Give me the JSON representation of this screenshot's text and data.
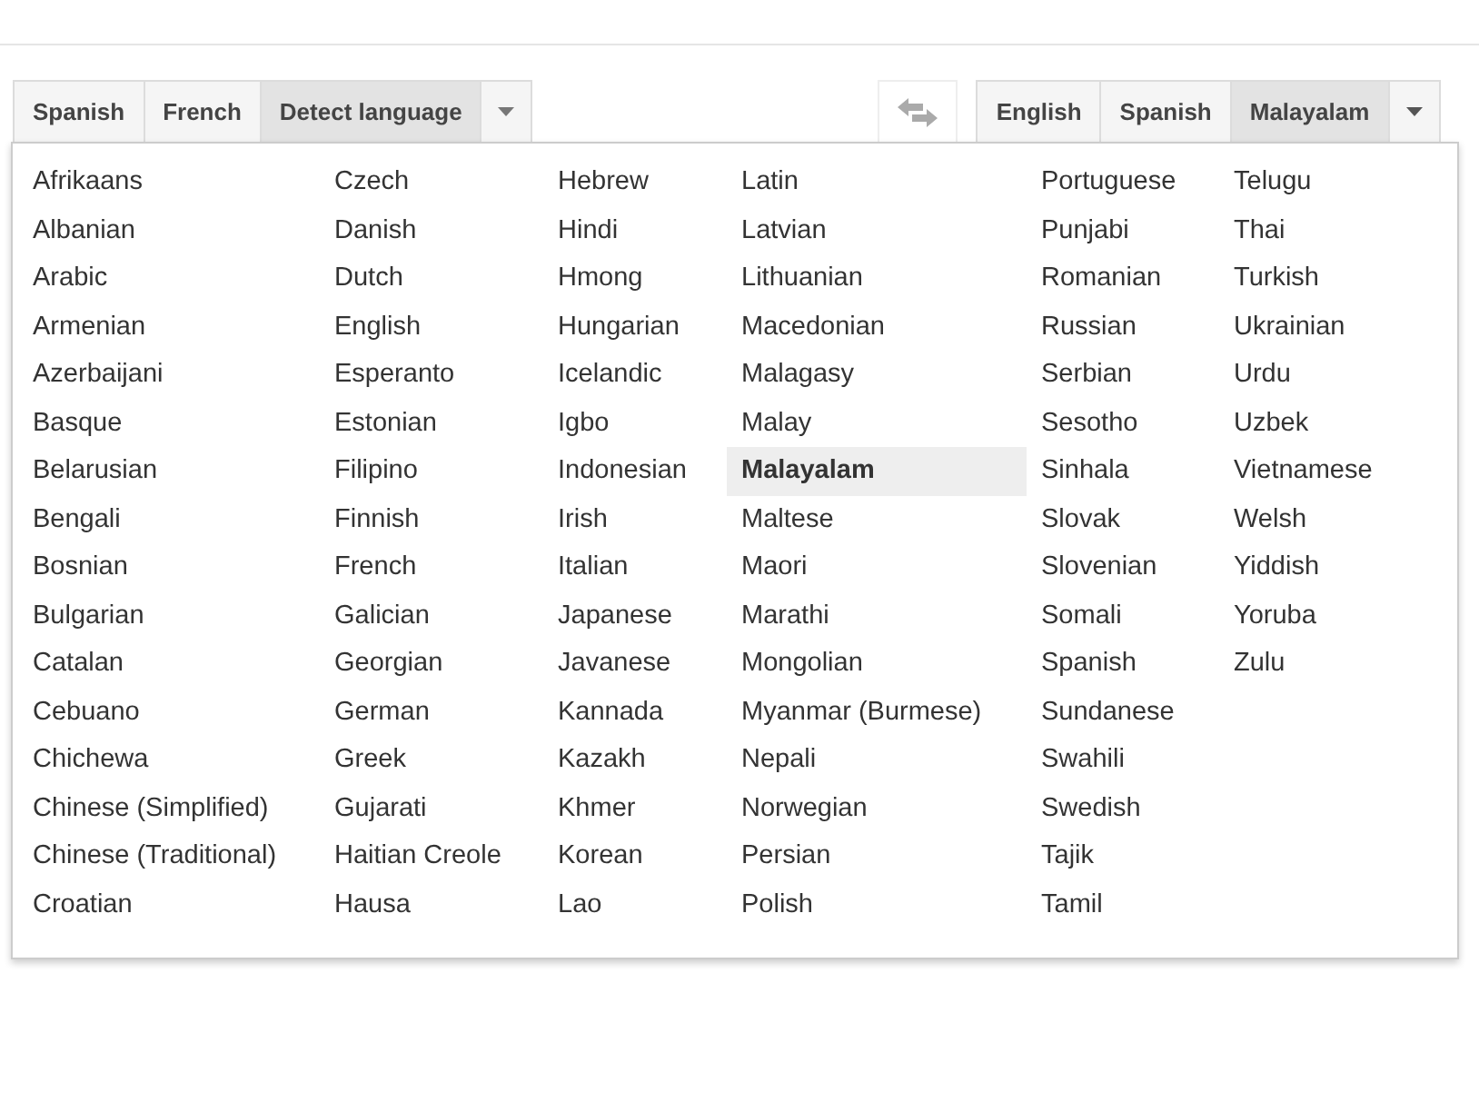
{
  "source_languages": [
    {
      "label": "Spanish",
      "selected": false
    },
    {
      "label": "French",
      "selected": false
    },
    {
      "label": "Detect language",
      "selected": true
    }
  ],
  "target_languages": [
    {
      "label": "English",
      "selected": false
    },
    {
      "label": "Spanish",
      "selected": false
    },
    {
      "label": "Malayalam",
      "selected": true
    }
  ],
  "language_menu": {
    "columns": [
      [
        {
          "label": "Afrikaans",
          "selected": false
        },
        {
          "label": "Albanian",
          "selected": false
        },
        {
          "label": "Arabic",
          "selected": false
        },
        {
          "label": "Armenian",
          "selected": false
        },
        {
          "label": "Azerbaijani",
          "selected": false
        },
        {
          "label": "Basque",
          "selected": false
        },
        {
          "label": "Belarusian",
          "selected": false
        },
        {
          "label": "Bengali",
          "selected": false
        },
        {
          "label": "Bosnian",
          "selected": false
        },
        {
          "label": "Bulgarian",
          "selected": false
        },
        {
          "label": "Catalan",
          "selected": false
        },
        {
          "label": "Cebuano",
          "selected": false
        },
        {
          "label": "Chichewa",
          "selected": false
        },
        {
          "label": "Chinese (Simplified)",
          "selected": false
        },
        {
          "label": "Chinese (Traditional)",
          "selected": false
        },
        {
          "label": "Croatian",
          "selected": false
        }
      ],
      [
        {
          "label": "Czech",
          "selected": false
        },
        {
          "label": "Danish",
          "selected": false
        },
        {
          "label": "Dutch",
          "selected": false
        },
        {
          "label": "English",
          "selected": false
        },
        {
          "label": "Esperanto",
          "selected": false
        },
        {
          "label": "Estonian",
          "selected": false
        },
        {
          "label": "Filipino",
          "selected": false
        },
        {
          "label": "Finnish",
          "selected": false
        },
        {
          "label": "French",
          "selected": false
        },
        {
          "label": "Galician",
          "selected": false
        },
        {
          "label": "Georgian",
          "selected": false
        },
        {
          "label": "German",
          "selected": false
        },
        {
          "label": "Greek",
          "selected": false
        },
        {
          "label": "Gujarati",
          "selected": false
        },
        {
          "label": "Haitian Creole",
          "selected": false
        },
        {
          "label": "Hausa",
          "selected": false
        }
      ],
      [
        {
          "label": "Hebrew",
          "selected": false
        },
        {
          "label": "Hindi",
          "selected": false
        },
        {
          "label": "Hmong",
          "selected": false
        },
        {
          "label": "Hungarian",
          "selected": false
        },
        {
          "label": "Icelandic",
          "selected": false
        },
        {
          "label": "Igbo",
          "selected": false
        },
        {
          "label": "Indonesian",
          "selected": false
        },
        {
          "label": "Irish",
          "selected": false
        },
        {
          "label": "Italian",
          "selected": false
        },
        {
          "label": "Japanese",
          "selected": false
        },
        {
          "label": "Javanese",
          "selected": false
        },
        {
          "label": "Kannada",
          "selected": false
        },
        {
          "label": "Kazakh",
          "selected": false
        },
        {
          "label": "Khmer",
          "selected": false
        },
        {
          "label": "Korean",
          "selected": false
        },
        {
          "label": "Lao",
          "selected": false
        }
      ],
      [
        {
          "label": "Latin",
          "selected": false
        },
        {
          "label": "Latvian",
          "selected": false
        },
        {
          "label": "Lithuanian",
          "selected": false
        },
        {
          "label": "Macedonian",
          "selected": false
        },
        {
          "label": "Malagasy",
          "selected": false
        },
        {
          "label": "Malay",
          "selected": false
        },
        {
          "label": "Malayalam",
          "selected": true
        },
        {
          "label": "Maltese",
          "selected": false
        },
        {
          "label": "Maori",
          "selected": false
        },
        {
          "label": "Marathi",
          "selected": false
        },
        {
          "label": "Mongolian",
          "selected": false
        },
        {
          "label": "Myanmar (Burmese)",
          "selected": false
        },
        {
          "label": "Nepali",
          "selected": false
        },
        {
          "label": "Norwegian",
          "selected": false
        },
        {
          "label": "Persian",
          "selected": false
        },
        {
          "label": "Polish",
          "selected": false
        }
      ],
      [
        {
          "label": "Portuguese",
          "selected": false
        },
        {
          "label": "Punjabi",
          "selected": false
        },
        {
          "label": "Romanian",
          "selected": false
        },
        {
          "label": "Russian",
          "selected": false
        },
        {
          "label": "Serbian",
          "selected": false
        },
        {
          "label": "Sesotho",
          "selected": false
        },
        {
          "label": "Sinhala",
          "selected": false
        },
        {
          "label": "Slovak",
          "selected": false
        },
        {
          "label": "Slovenian",
          "selected": false
        },
        {
          "label": "Somali",
          "selected": false
        },
        {
          "label": "Spanish",
          "selected": false
        },
        {
          "label": "Sundanese",
          "selected": false
        },
        {
          "label": "Swahili",
          "selected": false
        },
        {
          "label": "Swedish",
          "selected": false
        },
        {
          "label": "Tajik",
          "selected": false
        },
        {
          "label": "Tamil",
          "selected": false
        }
      ],
      [
        {
          "label": "Telugu",
          "selected": false
        },
        {
          "label": "Thai",
          "selected": false
        },
        {
          "label": "Turkish",
          "selected": false
        },
        {
          "label": "Ukrainian",
          "selected": false
        },
        {
          "label": "Urdu",
          "selected": false
        },
        {
          "label": "Uzbek",
          "selected": false
        },
        {
          "label": "Vietnamese",
          "selected": false
        },
        {
          "label": "Welsh",
          "selected": false
        },
        {
          "label": "Yiddish",
          "selected": false
        },
        {
          "label": "Yoruba",
          "selected": false
        },
        {
          "label": "Zulu",
          "selected": false
        }
      ]
    ]
  }
}
